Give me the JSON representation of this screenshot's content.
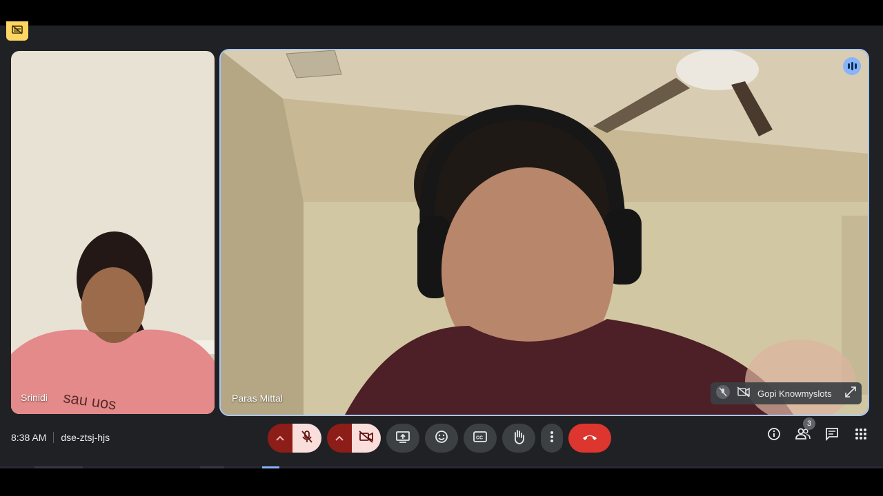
{
  "participants": {
    "left": {
      "name": "Srinidi"
    },
    "main": {
      "name": "Paras Mittal"
    },
    "mini": {
      "name": "Gopi Knowmyslots"
    }
  },
  "footer": {
    "time": "8:38 AM",
    "meeting_code": "dse-ztsj-hjs",
    "people_count": "3"
  },
  "shirt_text": "sau uos",
  "icons": {
    "mic": "mic-off-icon",
    "camera": "camera-off-icon",
    "present": "present-screen-icon",
    "emoji": "emoji-icon",
    "captions": "captions-icon",
    "hand": "raise-hand-icon",
    "more": "more-options-icon",
    "end": "end-call-icon",
    "info": "info-icon",
    "people": "people-icon",
    "chat": "chat-icon",
    "activities": "activities-icon"
  },
  "colors": {
    "accent": "#8ab4f8",
    "end_call": "#dc362e",
    "muted_bg": "#f9dedc",
    "caret_bg": "#8c1d18"
  }
}
